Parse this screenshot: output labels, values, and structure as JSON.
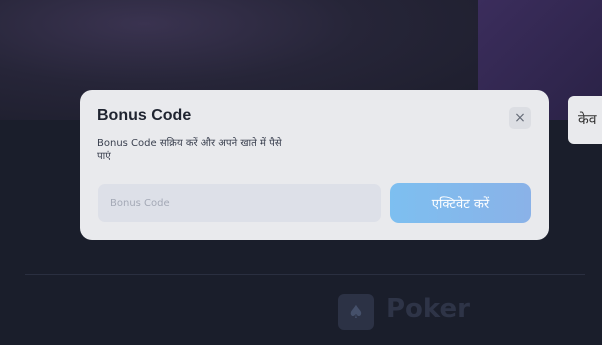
{
  "modal": {
    "title": "Bonus Code",
    "close_icon": "×",
    "description": "Bonus Code सक्रिय करें और अपने खाते में पैसे पाएं",
    "input_placeholder": "Bonus Code",
    "activate_label": "एक्टिवेट करें"
  },
  "background": {
    "side_button_label": "केव",
    "poker_label": "Poker",
    "colors": {
      "page": "#1b1f2e",
      "modal": "#e9eaed",
      "accent_button": "#7dbff0"
    }
  }
}
